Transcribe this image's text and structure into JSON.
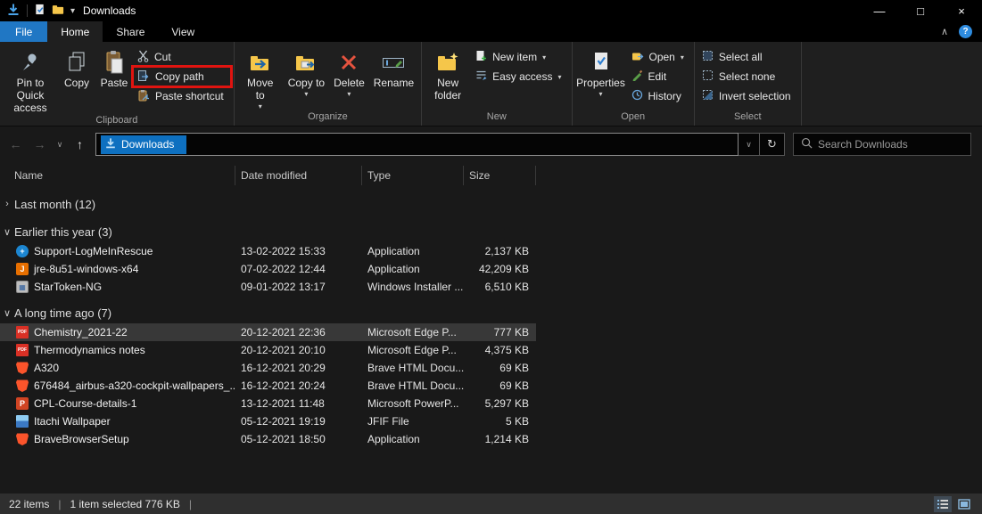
{
  "titlebar": {
    "title": "Downloads"
  },
  "tabs": {
    "file": "File",
    "home": "Home",
    "share": "Share",
    "view": "View"
  },
  "ribbon": {
    "clipboard": {
      "label": "Clipboard",
      "pin": "Pin to Quick access",
      "copy": "Copy",
      "paste": "Paste",
      "cut": "Cut",
      "copy_path": "Copy path",
      "paste_shortcut": "Paste shortcut"
    },
    "organize": {
      "label": "Organize",
      "move_to": "Move to",
      "copy_to": "Copy to",
      "delete": "Delete",
      "rename": "Rename"
    },
    "new": {
      "label": "New",
      "new_folder": "New folder",
      "new_item": "New item",
      "easy_access": "Easy access"
    },
    "open": {
      "label": "Open",
      "properties": "Properties",
      "open": "Open",
      "edit": "Edit",
      "history": "History"
    },
    "select": {
      "label": "Select",
      "select_all": "Select all",
      "select_none": "Select none",
      "invert": "Invert selection"
    }
  },
  "address_bar": {
    "location": "Downloads",
    "search_placeholder": "Search Downloads"
  },
  "columns": {
    "name": "Name",
    "date_modified": "Date modified",
    "type": "Type",
    "size": "Size"
  },
  "file_groups": [
    {
      "label": "Last month (12)",
      "collapsed": true,
      "files": []
    },
    {
      "label": "Earlier this year (3)",
      "collapsed": false,
      "files": [
        {
          "name": "Support-LogMeInRescue",
          "date": "13-02-2022 15:33",
          "type": "Application",
          "size": "2,137 KB",
          "icon": "logmein",
          "glyph": "+"
        },
        {
          "name": "jre-8u51-windows-x64",
          "date": "07-02-2022 12:44",
          "type": "Application",
          "size": "42,209 KB",
          "icon": "java",
          "glyph": "J"
        },
        {
          "name": "StarToken-NG",
          "date": "09-01-2022 13:17",
          "type": "Windows Installer ...",
          "size": "6,510 KB",
          "icon": "installer",
          "glyph": "▦"
        }
      ]
    },
    {
      "label": "A long time ago (7)",
      "collapsed": false,
      "files": [
        {
          "name": "Chemistry_2021-22",
          "date": "20-12-2021 22:36",
          "type": "Microsoft Edge P...",
          "size": "777 KB",
          "icon": "pdf",
          "glyph": "PDF",
          "selected": true
        },
        {
          "name": "Thermodynamics notes",
          "date": "20-12-2021 20:10",
          "type": "Microsoft Edge P...",
          "size": "4,375 KB",
          "icon": "pdf",
          "glyph": "PDF"
        },
        {
          "name": "A320",
          "date": "16-12-2021 20:29",
          "type": "Brave HTML Docu...",
          "size": "69 KB",
          "icon": "brave",
          "glyph": ""
        },
        {
          "name": "676484_airbus-a320-cockpit-wallpapers_...",
          "date": "16-12-2021 20:24",
          "type": "Brave HTML Docu...",
          "size": "69 KB",
          "icon": "brave",
          "glyph": ""
        },
        {
          "name": "CPL-Course-details-1",
          "date": "13-12-2021 11:48",
          "type": "Microsoft PowerP...",
          "size": "5,297 KB",
          "icon": "ppt",
          "glyph": "P"
        },
        {
          "name": "Itachi Wallpaper",
          "date": "05-12-2021 19:19",
          "type": "JFIF File",
          "size": "5 KB",
          "icon": "image",
          "glyph": ""
        },
        {
          "name": "BraveBrowserSetup",
          "date": "05-12-2021 18:50",
          "type": "Application",
          "size": "1,214 KB",
          "icon": "brave-setup",
          "glyph": ""
        }
      ]
    }
  ],
  "statusbar": {
    "items_count": "22 items",
    "selection": "1 item selected 776 KB",
    "separator": "|"
  },
  "icons": {
    "minimize": "—",
    "maximize": "□",
    "close": "×",
    "back": "←",
    "forward": "→",
    "up": "↑",
    "refresh": "↻",
    "dropdown": "▾",
    "chevron_down": "∨",
    "group_collapsed": "›",
    "group_expanded": "∨",
    "ribbon_collapse": "∧",
    "help": "?"
  },
  "colors": {
    "file_tab_blue": "#2077c4",
    "address_selection_blue": "#0e70c0",
    "highlight_red": "#e01410",
    "pdf_red": "#d93025",
    "brave_orange": "#fb542b",
    "background": "#191919",
    "ribbon_background": "#1f1f1f"
  }
}
